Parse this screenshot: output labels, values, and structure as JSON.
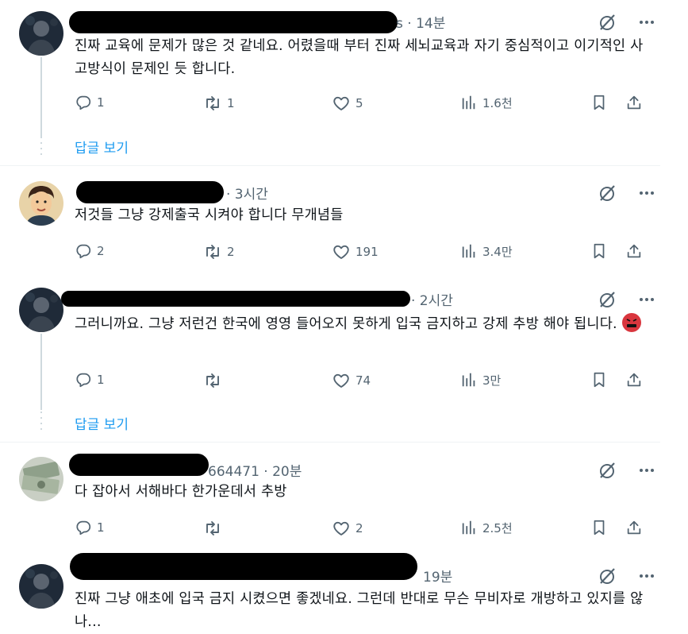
{
  "posts": [
    {
      "meta": "s · 14분",
      "text": "진짜 교육에 문제가 많은 것 같네요. 어렸을때 부터 진짜 세뇌교육과 자기 중심적이고 이기적인 사고방식이 문제인 듯 합니다.",
      "replies": "1",
      "reposts": "1",
      "likes": "5",
      "views": "1.6천",
      "show_replies": "답글 보기"
    },
    {
      "meta": "· 3시간",
      "text": "저것들 그냥 강제출국 시켜야 합니다 무개념들",
      "replies": "2",
      "reposts": "2",
      "likes": "191",
      "views": "3.4만"
    },
    {
      "meta": "· 2시간",
      "text": "그러니까요. 그냥 저런건 한국에 영영 들어오지 못하게 입국 금지하고 강제 추방 해야 됩니다.",
      "emoji": "angry-face-symbols-emoji",
      "replies": "1",
      "reposts": "",
      "likes": "74",
      "views": "3만",
      "show_replies": "답글 보기"
    },
    {
      "meta": "664471 · 20분",
      "text": "다 잡아서 서해바다 한가운데서 추방",
      "replies": "1",
      "reposts": "",
      "likes": "2",
      "views": "2.5천"
    },
    {
      "meta": "19분",
      "text": "진짜 그냥 애초에 입국 금지 시켰으면 좋겠네요. 그런데 반대로 무슨 무비자로 개방하고 있지를 않나..."
    }
  ],
  "icons": {
    "grok": "grok-slash-circle-icon",
    "more": "more-dots-icon",
    "reply": "reply-bubble-icon",
    "repost": "repost-arrows-icon",
    "like": "heart-icon",
    "views": "views-bars-icon",
    "bookmark": "bookmark-icon",
    "share": "share-upload-icon"
  },
  "colors": {
    "link": "#1d9bf0",
    "muted": "#536471",
    "text": "#0f1419"
  }
}
